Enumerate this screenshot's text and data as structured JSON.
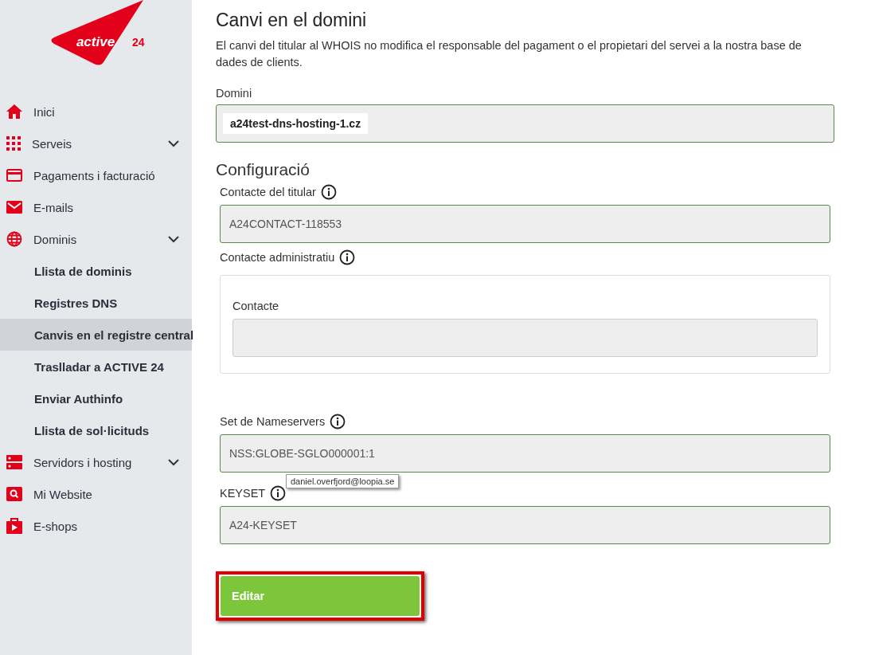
{
  "logo": {
    "word": "active",
    "number": "24"
  },
  "nav": [
    {
      "label": "Inici",
      "selected": false,
      "has_submenu": false
    },
    {
      "label": "Serveis",
      "selected": false,
      "has_submenu": true
    },
    {
      "label": "Pagaments i facturació",
      "selected": false,
      "has_submenu": false
    },
    {
      "label": "E-mails",
      "selected": false,
      "has_submenu": false
    },
    {
      "label": "Dominis",
      "selected": false,
      "has_submenu": true,
      "children": [
        {
          "label": "Llista de dominis",
          "selected": false
        },
        {
          "label": "Registres DNS",
          "selected": false
        },
        {
          "label": "Canvis en el registre central",
          "selected": true
        },
        {
          "label": "Traslladar a ACTIVE 24",
          "selected": false
        },
        {
          "label": "Enviar Authinfo",
          "selected": false
        },
        {
          "label": "Llista de sol·licituds",
          "selected": false
        }
      ]
    },
    {
      "label": "Servidors i hosting",
      "selected": false,
      "has_submenu": true
    },
    {
      "label": "Mi Website",
      "selected": false,
      "has_submenu": false
    },
    {
      "label": "E-shops",
      "selected": false,
      "has_submenu": false
    }
  ],
  "main": {
    "title": "Canvi en el domini",
    "description": "El canvi del titular al WHOIS no modifica el responsable del pagament o el propietari del servei a la nostra base de dades de clients.",
    "domain": {
      "label": "Domini",
      "value": "a24test-dns-hosting-1.cz"
    },
    "section_title": "Configuració",
    "fields": [
      {
        "kind": "field",
        "label": "Contacte del titular",
        "info": true,
        "value": "A24CONTACT-118553"
      },
      {
        "kind": "group",
        "label": "Contacte administratiu",
        "info": true,
        "inner_label": "Contacte"
      },
      {
        "kind": "field",
        "label": "Set de Nameservers",
        "info": true,
        "value": "NSS:GLOBE-SGLO000001:1",
        "tooltip": "daniel.overfjord@loopia.se"
      },
      {
        "kind": "field",
        "label": "KEYSET",
        "info": true,
        "value": "A24-KEYSET"
      }
    ],
    "button": {
      "label": "Editar",
      "highlighted": true
    }
  }
}
